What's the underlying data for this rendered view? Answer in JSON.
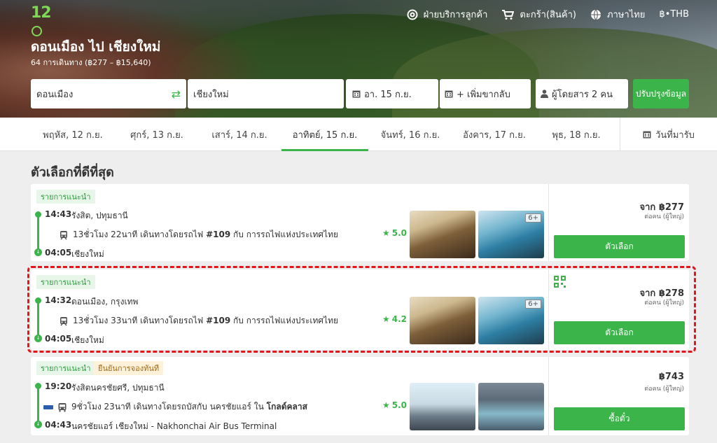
{
  "header": {
    "logo": "12Go",
    "nav": {
      "support": "ฝ่ายบริการลูกค้า",
      "cart": "ตะกร้า(สินค้า)",
      "language": "ภาษาไทย",
      "currency": "฿•THB"
    },
    "route_title": "ดอนเมือง ไป เชียงใหม่",
    "route_subtitle": "64 การเดินทาง (฿277 – ฿15,640)"
  },
  "search": {
    "from": "ดอนเมือง",
    "to": "เชียงใหม่",
    "date": "อา. 15 ก.ย.",
    "return": "+ เพิ่มขากลับ",
    "passengers": "ผู้โดยสาร 2 คน",
    "update_button": "ปรับปรุงข้อมูล"
  },
  "date_tabs": [
    {
      "label": "พฤหัส, 12 ก.ย."
    },
    {
      "label": "ศุกร์, 13 ก.ย."
    },
    {
      "label": "เสาร์, 14 ก.ย."
    },
    {
      "label": "อาทิตย์, 15 ก.ย."
    },
    {
      "label": "จันทร์, 16 ก.ย."
    },
    {
      "label": "อังคาร, 17 ก.ย."
    },
    {
      "label": "พุธ, 18 ก.ย."
    }
  ],
  "return_date_label": "วันที่มารับ",
  "section_title": "ตัวเลือกที่ดีที่สุด",
  "results": [
    {
      "badge": "รายการแนะนำ",
      "dep_time": "14:43",
      "dep_place": "รังสิต, ปทุมธานี",
      "duration": "13ชั่วโมง 22นาที เดินทางโดยรถไฟ",
      "train_no": "#109",
      "operator_prefix": "กับ",
      "operator": "การรถไฟแห่งประเทศไทย",
      "rating": "5.0",
      "arr_time": "04:05",
      "arr_place": "เชียงใหม่",
      "more_photos": "6+",
      "price": "จาก ฿277",
      "price_note": "ต่อคน (ผู้ใหญ่)",
      "button": "ตัวเลือก"
    },
    {
      "badge": "รายการแนะนำ",
      "dep_time": "14:32",
      "dep_place": "ดอนเมือง, กรุงเทพ",
      "duration": "13ชั่วโมง 33นาที เดินทางโดยรถไฟ",
      "train_no": "#109",
      "operator_prefix": "กับ",
      "operator": "การรถไฟแห่งประเทศไทย",
      "rating": "4.2",
      "arr_time": "04:05",
      "arr_place": "เชียงใหม่",
      "more_photos": "6+",
      "price": "จาก ฿278",
      "price_note": "ต่อคน (ผู้ใหญ่)",
      "button": "ตัวเลือก"
    },
    {
      "badge": "รายการแนะนำ",
      "badge2": "ยืนยันการจองทันที",
      "dep_time": "19:20",
      "dep_place": "รังสิตนครชัยศรี, ปทุมธานี",
      "duration": "9ชั่วโมง 23นาที เดินทางโดยรถบัสกับ นครชัยแอร์ ใน",
      "bus_class": "โกลด์คลาส",
      "rating": "5.0",
      "arr_time": "04:43",
      "arr_place": "นครชัยแอร์ เชียงใหม่ - Nakhonchai Air Bus Terminal",
      "price": "฿743",
      "price_note": "ต่อคน (ผู้ใหญ่)",
      "button": "ซื้อตั๋ว"
    }
  ],
  "colors": {
    "accent": "#3bb54a",
    "highlight_outline": "#e3151b"
  }
}
